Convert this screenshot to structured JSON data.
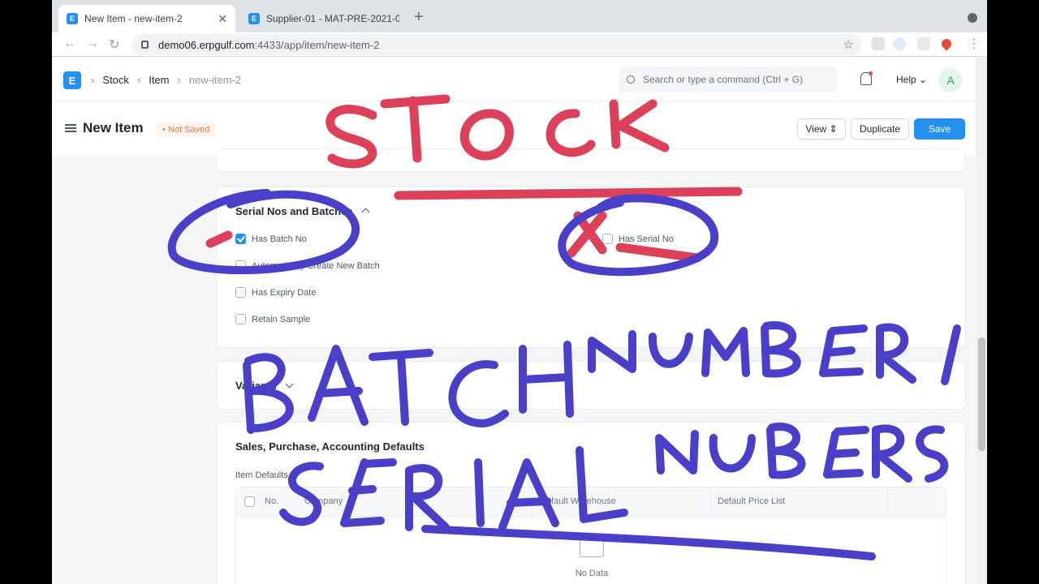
{
  "browser": {
    "tabs": [
      {
        "title": "New Item - new-item-2",
        "active": true
      },
      {
        "title": "Supplier-01 - MAT-PRE-2021-0",
        "active": false
      }
    ],
    "url_host": "demo06.erpgulf.com",
    "url_path": ":4433/app/item/new-item-2"
  },
  "navbar": {
    "logo": "E",
    "breadcrumbs": [
      "Stock",
      "Item",
      "new-item-2"
    ],
    "search_placeholder": "Search or type a command (Ctrl + G)",
    "help_label": "Help",
    "avatar_letter": "A"
  },
  "page": {
    "title": "New Item",
    "status": "Not Saved",
    "buttons": {
      "view": "View",
      "duplicate": "Duplicate",
      "save": "Save"
    }
  },
  "serial_section": {
    "title": "Serial Nos and Batches",
    "left": [
      {
        "label": "Has Batch No",
        "checked": true
      },
      {
        "label": "Automatically Create New Batch",
        "checked": false
      },
      {
        "label": "Has Expiry Date",
        "checked": false
      },
      {
        "label": "Retain Sample",
        "checked": false
      }
    ],
    "right": [
      {
        "label": "Has Serial No",
        "checked": false
      }
    ]
  },
  "collapsed_section": {
    "title": "Variants"
  },
  "defaults_section": {
    "title": "Sales, Purchase, Accounting Defaults",
    "table_label": "Item Defaults",
    "columns": [
      "No.",
      "Company",
      "Default Warehouse",
      "Default Price List"
    ],
    "empty_text": "No Data"
  },
  "annotations": {
    "top": "STOCK",
    "middle": "BATCH NUMBERS",
    "bottom": "SERIAL NUBERS",
    "ink_red": "#dc4159",
    "ink_blue": "#4a3fc8"
  }
}
